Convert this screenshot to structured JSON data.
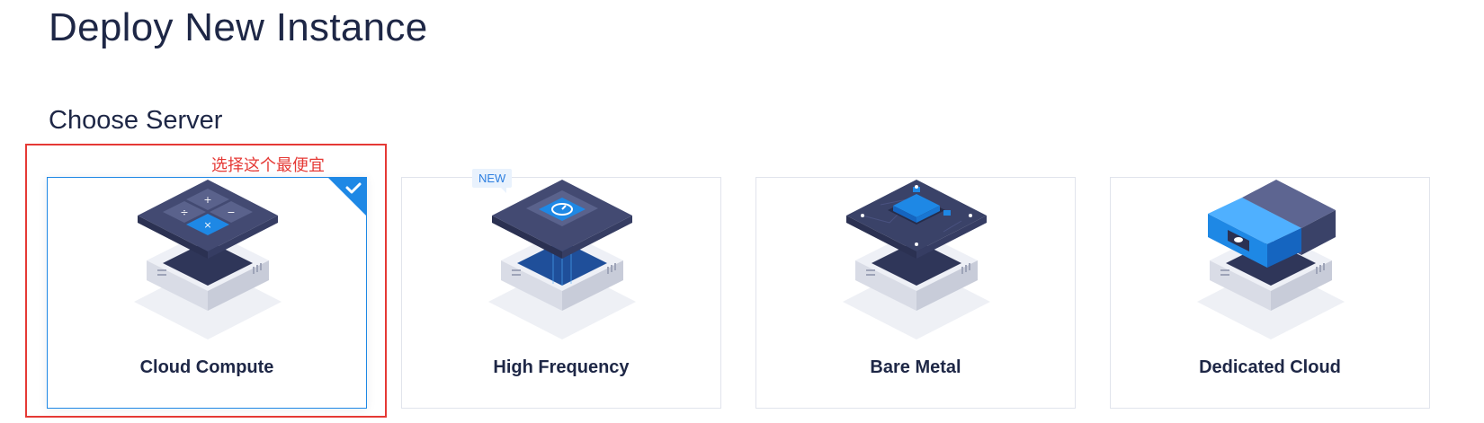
{
  "page": {
    "title": "Deploy New Instance"
  },
  "section": {
    "title": "Choose Server"
  },
  "annotation": {
    "text": "选择这个最便宜"
  },
  "server_types": [
    {
      "label": "Cloud Compute",
      "selected": true,
      "icon": "calculator-server-icon"
    },
    {
      "label": "High Frequency",
      "selected": false,
      "icon": "gauge-server-icon",
      "badge": "NEW"
    },
    {
      "label": "Bare Metal",
      "selected": false,
      "icon": "chip-server-icon"
    },
    {
      "label": "Dedicated Cloud",
      "selected": false,
      "icon": "cloud-server-icon"
    }
  ],
  "colors": {
    "accent": "#1e88e5",
    "annotation": "#e53935",
    "dark_slate": "#3a4268",
    "text": "#1e2746"
  }
}
